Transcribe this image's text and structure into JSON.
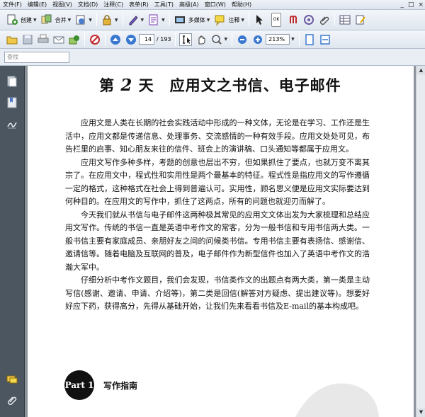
{
  "menu": [
    "文件(F)",
    "编辑(E)",
    "视图(V)",
    "文档(D)",
    "注释(C)",
    "表单(R)",
    "工具(T)",
    "高级(A)",
    "窗口(W)",
    "帮助(H)"
  ],
  "window_controls": [
    "_",
    "□",
    "×"
  ],
  "toolbar1": {
    "create_label": "创建",
    "combine_label": "合并",
    "multimedia_label": "多媒体",
    "comment_label": "注释",
    "ok_label": "OK"
  },
  "toolbar2": {
    "page_current": "14",
    "page_total": "/ 193",
    "zoom": "213%"
  },
  "find": {
    "placeholder": "查找"
  },
  "document": {
    "title_pre": "第",
    "title_num": "2",
    "title_post": "天　应用文之书信、电子邮件",
    "paragraphs": [
      "应用文是人类在长期的社会实践活动中形成的一种文体，无论是在学习、工作还是生活中，应用文都是传递信息、处理事务、交流感情的一种有效手段。应用文处处可见，布告栏里的启事、知心朋友来往的信件、班会上的演讲稿、口头通知等都属于应用文。",
      "应用文写作多种多样，考题的创意也层出不穷，但如果抓住了要点，也就万变不离其宗了。在应用文中，程式性和实用性是两个最基本的特征。程式性是指应用文的写作遵循一定的格式，这种格式在社会上得到普遍认可。实用性，顾名思义便是应用文实际要达到何种目的。在应用文的写作中，抓住了这两点，所有的问题也就迎刃而解了。",
      "今天我们就从书信与电子邮件这两种极其常见的应用文文体出发为大家梳理和总结应用文写作。传统的书信一直是英语中考作文的常客，分为一般书信和专用书信两大类。一般书信主要有家庭成员、亲朋好友之间的问候类书信。专用书信主要有表扬信、感谢信、邀请信等。随着电脑及互联网的普及，电子邮件作为新型信件也加入了英语中考作文的浩瀚大军中。",
      "仔细分析中考作文题目，我们会发现，书信类作文的出题点有两大类，第一类是主动写信(感谢、邀请、申请、介绍等)，第二类是回信(解答对方疑虑、提出建议等)。想要好好应下药，获得高分，先得从基础开始，让我们先来看看书信及E-mail的基本构成吧。"
    ],
    "part_label": "Part 1",
    "part_title": "写作指南"
  }
}
